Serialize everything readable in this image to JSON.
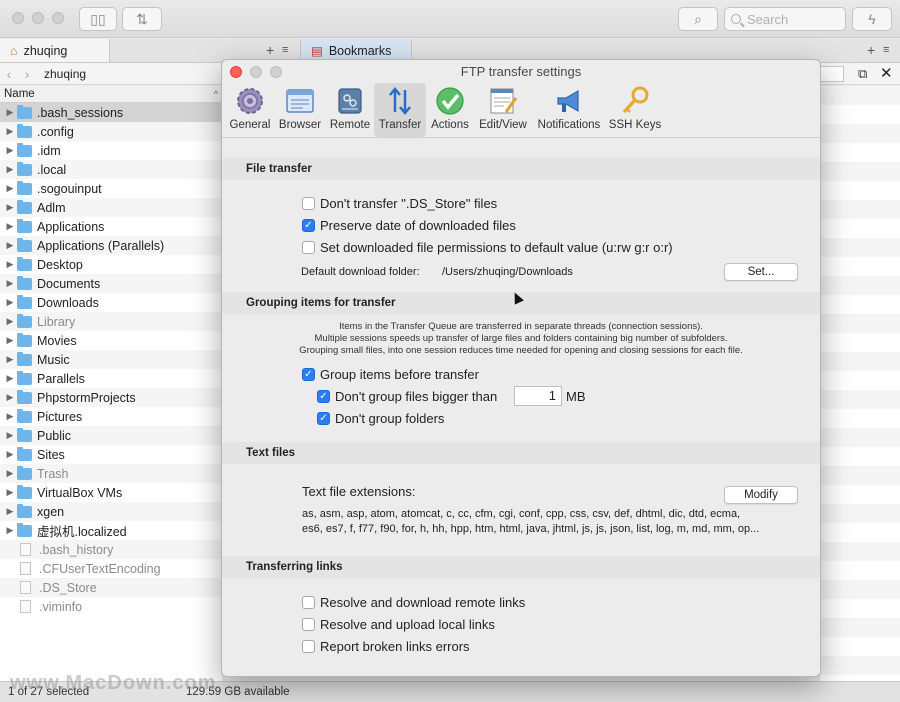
{
  "toolbar": {
    "search_placeholder": "Search"
  },
  "tabs": {
    "left": {
      "label": "zhuqing"
    },
    "right": {
      "label": "Bookmarks"
    }
  },
  "path": {
    "current": "zhuqing"
  },
  "filelist": {
    "column": "Name",
    "items": [
      {
        "name": ".bash_sessions",
        "kind": "folder",
        "selected": true
      },
      {
        "name": ".config",
        "kind": "folder"
      },
      {
        "name": ".idm",
        "kind": "folder"
      },
      {
        "name": ".local",
        "kind": "folder"
      },
      {
        "name": ".sogouinput",
        "kind": "folder"
      },
      {
        "name": "Adlm",
        "kind": "folder"
      },
      {
        "name": "Applications",
        "kind": "folder"
      },
      {
        "name": "Applications (Parallels)",
        "kind": "folder"
      },
      {
        "name": "Desktop",
        "kind": "folder"
      },
      {
        "name": "Documents",
        "kind": "folder"
      },
      {
        "name": "Downloads",
        "kind": "folder"
      },
      {
        "name": "Library",
        "kind": "folder",
        "dim": true
      },
      {
        "name": "Movies",
        "kind": "folder"
      },
      {
        "name": "Music",
        "kind": "folder"
      },
      {
        "name": "Parallels",
        "kind": "folder"
      },
      {
        "name": "PhpstormProjects",
        "kind": "folder"
      },
      {
        "name": "Pictures",
        "kind": "folder"
      },
      {
        "name": "Public",
        "kind": "folder"
      },
      {
        "name": "Sites",
        "kind": "folder"
      },
      {
        "name": "Trash",
        "kind": "folder",
        "dim": true
      },
      {
        "name": "VirtualBox VMs",
        "kind": "folder"
      },
      {
        "name": "xgen",
        "kind": "folder"
      },
      {
        "name": "虚拟机.localized",
        "kind": "folder"
      },
      {
        "name": ".bash_history",
        "kind": "file",
        "dim": true
      },
      {
        "name": ".CFUserTextEncoding",
        "kind": "file",
        "dim": true
      },
      {
        "name": ".DS_Store",
        "kind": "file",
        "dim": true
      },
      {
        "name": ".viminfo",
        "kind": "file",
        "dim": true
      }
    ]
  },
  "status": {
    "selection": "1 of 27 selected",
    "available": "129.59 GB available",
    "watermark": "www.MacDown.com"
  },
  "dialog": {
    "title": "FTP transfer settings",
    "prefs": [
      {
        "label": "General",
        "icon": "gear-icon"
      },
      {
        "label": "Browser",
        "icon": "browser-icon"
      },
      {
        "label": "Remote",
        "icon": "remote-drive-icon"
      },
      {
        "label": "Transfer",
        "icon": "transfer-arrows-icon",
        "active": true
      },
      {
        "label": "Actions",
        "icon": "checkmark-icon"
      },
      {
        "label": "Edit/View",
        "icon": "edit-view-icon"
      },
      {
        "label": "Notifications",
        "icon": "megaphone-icon"
      },
      {
        "label": "SSH Keys",
        "icon": "key-icon"
      }
    ],
    "file_transfer": {
      "title": "File transfer",
      "dont_transfer_ds": "Don't transfer \".DS_Store\" files",
      "preserve_date": "Preserve date of downloaded files",
      "set_permissions": "Set downloaded file permissions to default value (u:rw g:r o:r)",
      "folder_label": "Default download folder:",
      "folder_value": "/Users/zhuqing/Downloads",
      "set_button": "Set..."
    },
    "grouping": {
      "title": "Grouping items for transfer",
      "note1": "Items in the Transfer Queue are transferred in separate threads (connection sessions).",
      "note2": "Multiple sessions speeds up transfer of large files and folders containing big number of subfolders.",
      "note3": "Grouping small files, into one session reduces time needed for opening and closing sessions for each file.",
      "group_items": "Group items before transfer",
      "dont_group_bigger": "Don't group files bigger than",
      "size_value": "1",
      "size_unit": "MB",
      "dont_group_folders": "Don't group folders"
    },
    "text_files": {
      "title": "Text files",
      "ext_label": "Text file extensions:",
      "modify_button": "Modify",
      "ext_line1": "as, asm, asp, atom, atomcat, c, cc, cfm, cgi, conf, cpp, css, csv, def, dhtml, dic, dtd, ecma,",
      "ext_line2": "es6, es7, f, f77, f90, for, h, hh, hpp, htm, html, java, jhtml, js, js, json, list, log, m, md, mm, op..."
    },
    "links": {
      "title": "Transferring links",
      "resolve_remote": "Resolve and download remote links",
      "resolve_local": "Resolve and upload local links",
      "report_broken": "Report broken links errors"
    }
  }
}
